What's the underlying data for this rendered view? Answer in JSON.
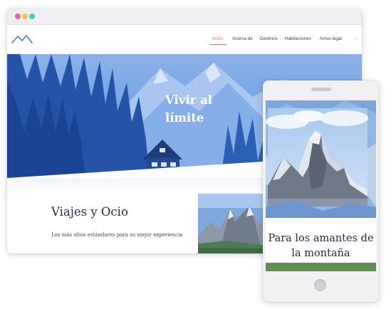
{
  "browser": {
    "dots": [
      "pink-dot",
      "yellow-dot",
      "teal-dot"
    ]
  },
  "site": {
    "logo": "mountain-logo-icon",
    "nav": {
      "items": [
        "Inicio",
        "Acerca de",
        "Destinos",
        "Habitaciones",
        "Aviso legal",
        "···"
      ],
      "active_index": 0
    },
    "hero": {
      "title_line1": "Vivir al",
      "title_line2": "límite"
    },
    "section": {
      "heading": "Viajes y Ocio",
      "subtitle": "Los más altos estándares para su mejor experiencia"
    }
  },
  "phone": {
    "card_title_line1": "Para los amantes de",
    "card_title_line2": "la montaña"
  },
  "colors": {
    "accent": "#e0755a",
    "hero_blue": "#2f6fd0",
    "heading_navy": "#262c48",
    "dot_pink": "#ef5fa7",
    "dot_yellow": "#f5c542",
    "dot_teal": "#44c8bf"
  }
}
